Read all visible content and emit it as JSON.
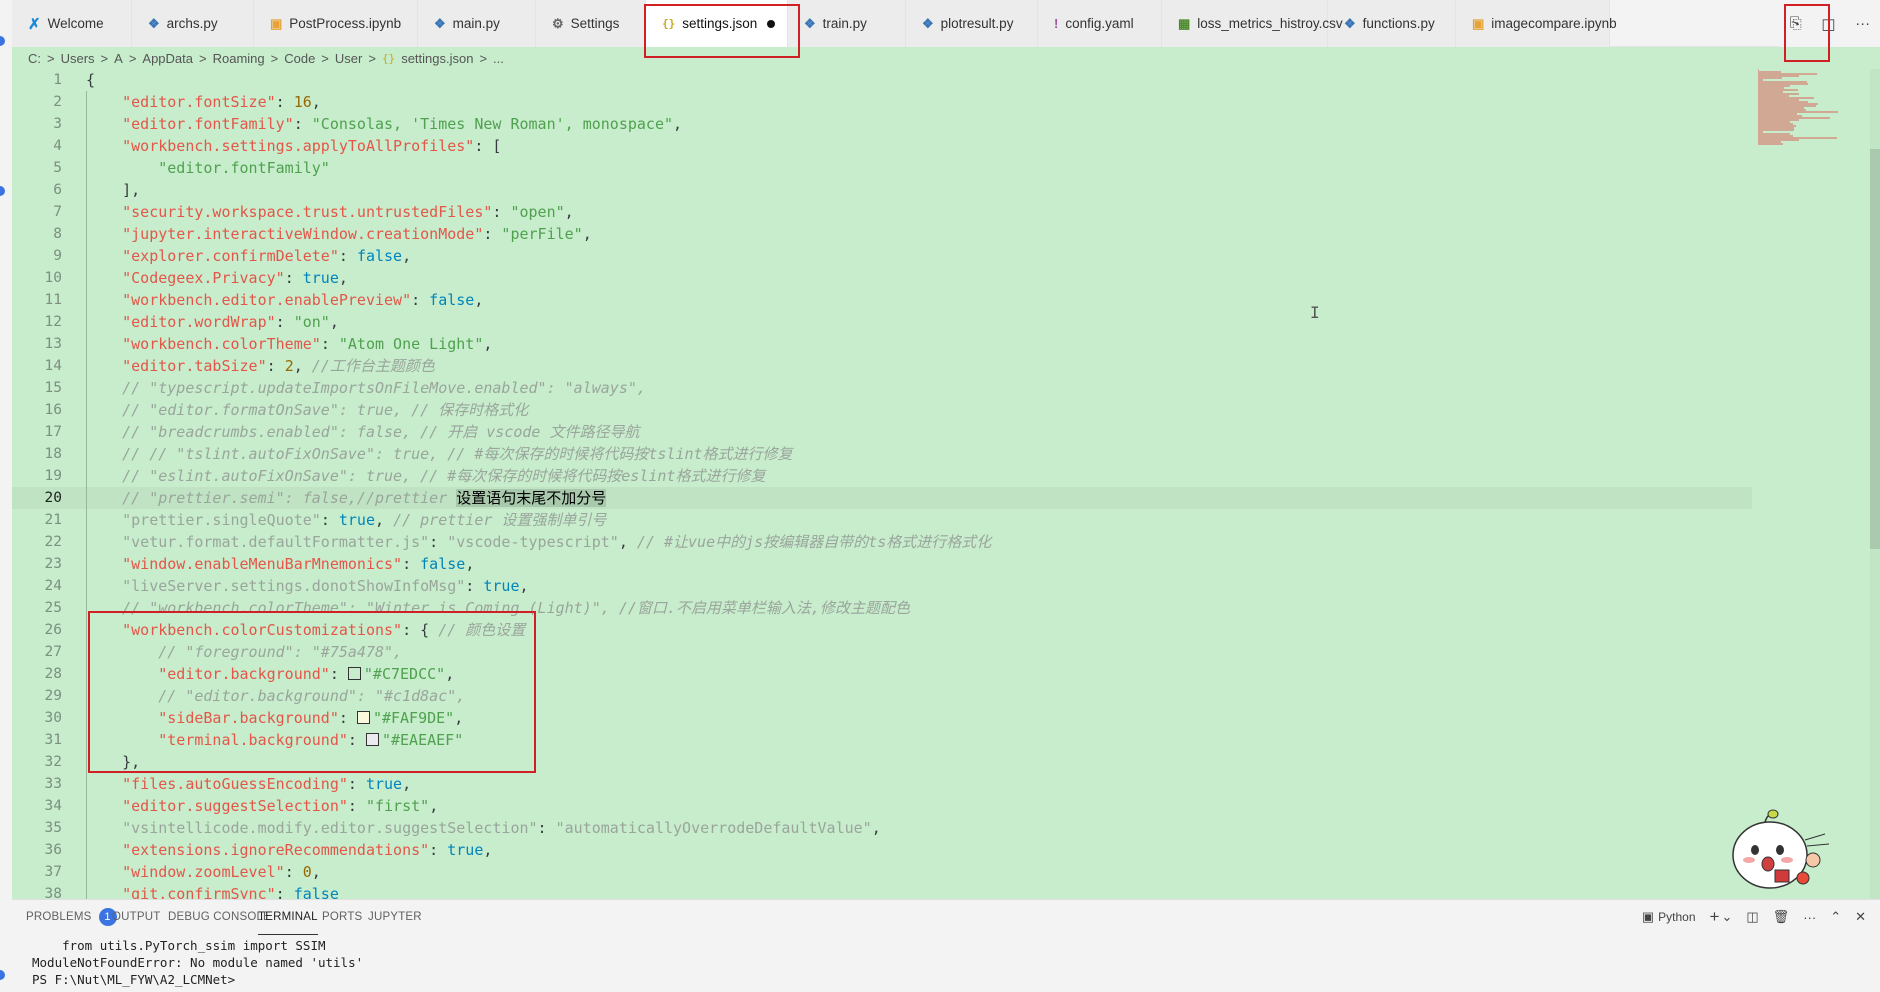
{
  "tabs": [
    {
      "label": "Welcome",
      "icon": "vscode-icon",
      "icon_glyph": "✗",
      "kind": "vscode"
    },
    {
      "label": "archs.py",
      "icon": "python-file-icon",
      "icon_glyph": "❖",
      "kind": "py"
    },
    {
      "label": "PostProcess.ipynb",
      "icon": "notebook-file-icon",
      "icon_glyph": "▣",
      "kind": "ipynb"
    },
    {
      "label": "main.py",
      "icon": "python-file-icon",
      "icon_glyph": "❖",
      "kind": "py"
    },
    {
      "label": "Settings",
      "icon": "settings-icon",
      "icon_glyph": "⚙",
      "kind": "settings"
    },
    {
      "label": "settings.json",
      "icon": "json-file-icon",
      "icon_glyph": "{}",
      "kind": "json",
      "active": true,
      "dirty": true
    },
    {
      "label": "train.py",
      "icon": "python-file-icon",
      "icon_glyph": "❖",
      "kind": "py"
    },
    {
      "label": "plotresult.py",
      "icon": "python-file-icon",
      "icon_glyph": "❖",
      "kind": "py"
    },
    {
      "label": "config.yaml",
      "icon": "yaml-file-icon",
      "icon_glyph": "!",
      "kind": "yaml"
    },
    {
      "label": "loss_metrics_histroy.csv",
      "icon": "csv-file-icon",
      "icon_glyph": "▦",
      "kind": "csv"
    },
    {
      "label": "functions.py",
      "icon": "python-file-icon",
      "icon_glyph": "❖",
      "kind": "py"
    },
    {
      "label": "imagecompare.ipynb",
      "icon": "notebook-file-icon",
      "icon_glyph": "▣",
      "kind": "ipynb"
    }
  ],
  "tab_actions": {
    "open_changes": "⎘",
    "split": "◫",
    "more": "···"
  },
  "breadcrumb": [
    "C:",
    "Users",
    "A",
    "AppData",
    "Roaming",
    "Code",
    "User",
    "settings.json",
    "..."
  ],
  "breadcrumb_sep": ">",
  "current_line": 20,
  "editor_lines": [
    [
      [
        "p",
        "{"
      ]
    ],
    [
      [
        "p",
        "    "
      ],
      [
        "k",
        "\"editor.fontSize\""
      ],
      [
        "p",
        ": "
      ],
      [
        "n",
        "16"
      ],
      [
        "p",
        ","
      ]
    ],
    [
      [
        "p",
        "    "
      ],
      [
        "k",
        "\"editor.fontFamily\""
      ],
      [
        "p",
        ": "
      ],
      [
        "s",
        "\"Consolas, 'Times New Roman', monospace\""
      ],
      [
        "p",
        ","
      ]
    ],
    [
      [
        "p",
        "    "
      ],
      [
        "k",
        "\"workbench.settings.applyToAllProfiles\""
      ],
      [
        "p",
        ": ["
      ]
    ],
    [
      [
        "p",
        "        "
      ],
      [
        "s",
        "\"editor.fontFamily\""
      ]
    ],
    [
      [
        "p",
        "    ],"
      ]
    ],
    [
      [
        "p",
        "    "
      ],
      [
        "k",
        "\"security.workspace.trust.untrustedFiles\""
      ],
      [
        "p",
        ": "
      ],
      [
        "s",
        "\"open\""
      ],
      [
        "p",
        ","
      ]
    ],
    [
      [
        "p",
        "    "
      ],
      [
        "k",
        "\"jupyter.interactiveWindow.creationMode\""
      ],
      [
        "p",
        ": "
      ],
      [
        "s",
        "\"perFile\""
      ],
      [
        "p",
        ","
      ]
    ],
    [
      [
        "p",
        "    "
      ],
      [
        "k",
        "\"explorer.confirmDelete\""
      ],
      [
        "p",
        ": "
      ],
      [
        "b",
        "false"
      ],
      [
        "p",
        ","
      ]
    ],
    [
      [
        "p",
        "    "
      ],
      [
        "k",
        "\"Codegeex.Privacy\""
      ],
      [
        "p",
        ": "
      ],
      [
        "b",
        "true"
      ],
      [
        "p",
        ","
      ]
    ],
    [
      [
        "p",
        "    "
      ],
      [
        "k",
        "\"workbench.editor.enablePreview\""
      ],
      [
        "p",
        ": "
      ],
      [
        "b",
        "false"
      ],
      [
        "p",
        ","
      ]
    ],
    [
      [
        "p",
        "    "
      ],
      [
        "k",
        "\"editor.wordWrap\""
      ],
      [
        "p",
        ": "
      ],
      [
        "s",
        "\"on\""
      ],
      [
        "p",
        ","
      ]
    ],
    [
      [
        "p",
        "    "
      ],
      [
        "k",
        "\"workbench.colorTheme\""
      ],
      [
        "p",
        ": "
      ],
      [
        "s",
        "\"Atom One Light\""
      ],
      [
        "p",
        ","
      ]
    ],
    [
      [
        "p",
        "    "
      ],
      [
        "k",
        "\"editor.tabSize\""
      ],
      [
        "p",
        ": "
      ],
      [
        "n",
        "2"
      ],
      [
        "p",
        ", "
      ],
      [
        "c",
        "//工作台主题颜色"
      ]
    ],
    [
      [
        "p",
        "    "
      ],
      [
        "c",
        "// \"typescript.updateImportsOnFileMove.enabled\": \"always\","
      ]
    ],
    [
      [
        "p",
        "    "
      ],
      [
        "c",
        "// \"editor.formatOnSave\": true, // 保存时格式化"
      ]
    ],
    [
      [
        "p",
        "    "
      ],
      [
        "c",
        "// \"breadcrumbs.enabled\": false, // 开启 vscode 文件路径导航"
      ]
    ],
    [
      [
        "p",
        "    "
      ],
      [
        "c",
        "// // \"tslint.autoFixOnSave\": true, // #每次保存的时候将代码按tslint格式进行修复"
      ]
    ],
    [
      [
        "p",
        "    "
      ],
      [
        "c",
        "// \"eslint.autoFixOnSave\": true, // #每次保存的时候将代码按eslint格式进行修复"
      ]
    ],
    [
      [
        "p",
        "    "
      ],
      [
        "c",
        "// \"prettier.semi\": false,//prettier "
      ],
      [
        "sel",
        "设置语句末尾不加分号"
      ]
    ],
    [
      [
        "p",
        "    "
      ],
      [
        "cs",
        "\"prettier.singleQuote\""
      ],
      [
        "p",
        ": "
      ],
      [
        "b",
        "true"
      ],
      [
        "p",
        ", "
      ],
      [
        "c",
        "// prettier 设置强制单引号"
      ]
    ],
    [
      [
        "p",
        "    "
      ],
      [
        "cs",
        "\"vetur.format.defaultFormatter.js\""
      ],
      [
        "p",
        ": "
      ],
      [
        "cs",
        "\"vscode-typescript\""
      ],
      [
        "p",
        ", "
      ],
      [
        "c",
        "// #让vue中的js按编辑器自带的ts格式进行格式化"
      ]
    ],
    [
      [
        "p",
        "    "
      ],
      [
        "k",
        "\"window.enableMenuBarMnemonics\""
      ],
      [
        "p",
        ": "
      ],
      [
        "b",
        "false"
      ],
      [
        "p",
        ","
      ]
    ],
    [
      [
        "p",
        "    "
      ],
      [
        "cs",
        "\"liveServer.settings.donotShowInfoMsg\""
      ],
      [
        "p",
        ": "
      ],
      [
        "b",
        "true"
      ],
      [
        "p",
        ","
      ]
    ],
    [
      [
        "p",
        "    "
      ],
      [
        "c",
        "// \"workbench.colorTheme\": \"Winter is Coming (Light)\", //窗口.不启用菜单栏输入法,修改主题配色"
      ]
    ],
    [
      [
        "p",
        "    "
      ],
      [
        "k",
        "\"workbench.colorCustomizations\""
      ],
      [
        "p",
        ": { "
      ],
      [
        "c",
        "// 颜色设置"
      ]
    ],
    [
      [
        "p",
        "        "
      ],
      [
        "c",
        "// \"foreground\": \"#75a478\","
      ]
    ],
    [
      [
        "p",
        "        "
      ],
      [
        "k",
        "\"editor.background\""
      ],
      [
        "p",
        ": "
      ],
      [
        "sw",
        "#C7EDCC"
      ],
      [
        "s",
        "\"#C7EDCC\""
      ],
      [
        "p",
        ","
      ]
    ],
    [
      [
        "p",
        "        "
      ],
      [
        "c",
        "// \"editor.background\": \"#c1d8ac\","
      ]
    ],
    [
      [
        "p",
        "        "
      ],
      [
        "k",
        "\"sideBar.background\""
      ],
      [
        "p",
        ": "
      ],
      [
        "sw",
        "#FAF9DE"
      ],
      [
        "s",
        "\"#FAF9DE\""
      ],
      [
        "p",
        ","
      ]
    ],
    [
      [
        "p",
        "        "
      ],
      [
        "k",
        "\"terminal.background\""
      ],
      [
        "p",
        ": "
      ],
      [
        "sw",
        "#EAEAEF"
      ],
      [
        "s",
        "\"#EAEAEF\""
      ]
    ],
    [
      [
        "p",
        "    },"
      ]
    ],
    [
      [
        "p",
        "    "
      ],
      [
        "k",
        "\"files.autoGuessEncoding\""
      ],
      [
        "p",
        ": "
      ],
      [
        "b",
        "true"
      ],
      [
        "p",
        ","
      ]
    ],
    [
      [
        "p",
        "    "
      ],
      [
        "k",
        "\"editor.suggestSelection\""
      ],
      [
        "p",
        ": "
      ],
      [
        "s",
        "\"first\""
      ],
      [
        "p",
        ","
      ]
    ],
    [
      [
        "p",
        "    "
      ],
      [
        "cs",
        "\"vsintellicode.modify.editor.suggestSelection\""
      ],
      [
        "p",
        ": "
      ],
      [
        "cs",
        "\"automaticallyOverrodeDefaultValue\""
      ],
      [
        "p",
        ","
      ]
    ],
    [
      [
        "p",
        "    "
      ],
      [
        "k",
        "\"extensions.ignoreRecommendations\""
      ],
      [
        "p",
        ": "
      ],
      [
        "b",
        "true"
      ],
      [
        "p",
        ","
      ]
    ],
    [
      [
        "p",
        "    "
      ],
      [
        "k",
        "\"window.zoomLevel\""
      ],
      [
        "p",
        ": "
      ],
      [
        "n",
        "0"
      ],
      [
        "p",
        ","
      ]
    ],
    [
      [
        "p",
        "    "
      ],
      [
        "k",
        "\"git.confirmSync\""
      ],
      [
        "p",
        ": "
      ],
      [
        "b",
        "false"
      ]
    ]
  ],
  "panel": {
    "tabs": [
      {
        "label": "PROBLEMS",
        "badge": "1"
      },
      {
        "label": "OUTPUT"
      },
      {
        "label": "DEBUG CONSOLE"
      },
      {
        "label": "TERMINAL",
        "active": true
      },
      {
        "label": "PORTS"
      },
      {
        "label": "JUPYTER"
      }
    ],
    "terminal_name": "Python",
    "actions": {
      "terminal_icon": "▣",
      "add": "+",
      "add_menu": "⌄",
      "split": "◫",
      "trash": "🗑",
      "more": "···",
      "maximize": "⌃",
      "close": "✕"
    },
    "terminal_lines": [
      "    from utils.PyTorch_ssim import SSIM",
      "ModuleNotFoundError: No module named 'utils'",
      "PS F:\\Nut\\ML_FYW\\A2_LCMNet>"
    ]
  },
  "colors": {
    "editor_bg": "#C7EDCC",
    "highlight_box": "#d01f25",
    "accent": "#3b73e0"
  }
}
